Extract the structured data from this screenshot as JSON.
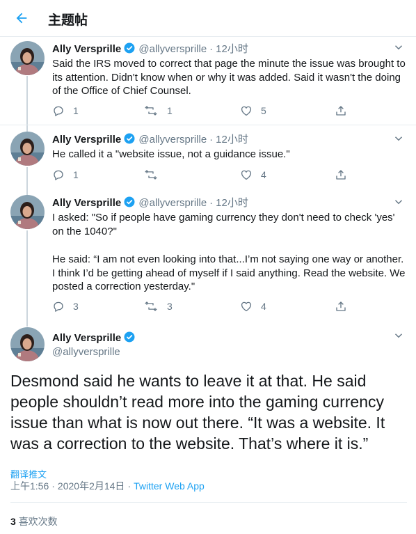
{
  "header": {
    "title": "主题帖",
    "back_icon": "arrow-left-icon"
  },
  "author": {
    "name": "Ally Versprille",
    "handle": "@allyversprille",
    "verified_color": "#1da1f2"
  },
  "tweets": [
    {
      "time": "12小时",
      "text": "Said the IRS moved to correct that page the minute the issue was brought to its attention. Didn't know when or why it was added. Said it wasn't the doing of the Office of Chief Counsel.",
      "replies": "1",
      "retweets": "1",
      "likes": "5"
    },
    {
      "time": "12小时",
      "text": "He called it a \"website issue, not a guidance issue.\"",
      "replies": "1",
      "retweets": "",
      "likes": "4"
    },
    {
      "time": "12小时",
      "text1": "I asked: \"So if people have gaming currency they don't need to check 'yes' on the 1040?\"",
      "text2": "He said: “I am not even looking into that...I’m not saying one way or another. I think I’d be getting ahead of myself if I said anything. Read the website. We posted a correction yesterday.\"",
      "replies": "3",
      "retweets": "3",
      "likes": "4"
    }
  ],
  "main_tweet": {
    "text": "Desmond said he wants to leave it at that. He said people shouldn’t read more into the gaming currency issue than what is now out there. “It was a website. It was a correction to the website. That’s where it is.”",
    "translate_label": "翻译推文",
    "time": "上午1:56",
    "date": "2020年2月14日",
    "separator": "·",
    "app": "Twitter Web App",
    "likes_count": "3",
    "likes_label": "喜欢次数"
  },
  "colors": {
    "accent": "#1da1f2",
    "secondary_text": "#657786",
    "divider": "#e6ecf0"
  }
}
